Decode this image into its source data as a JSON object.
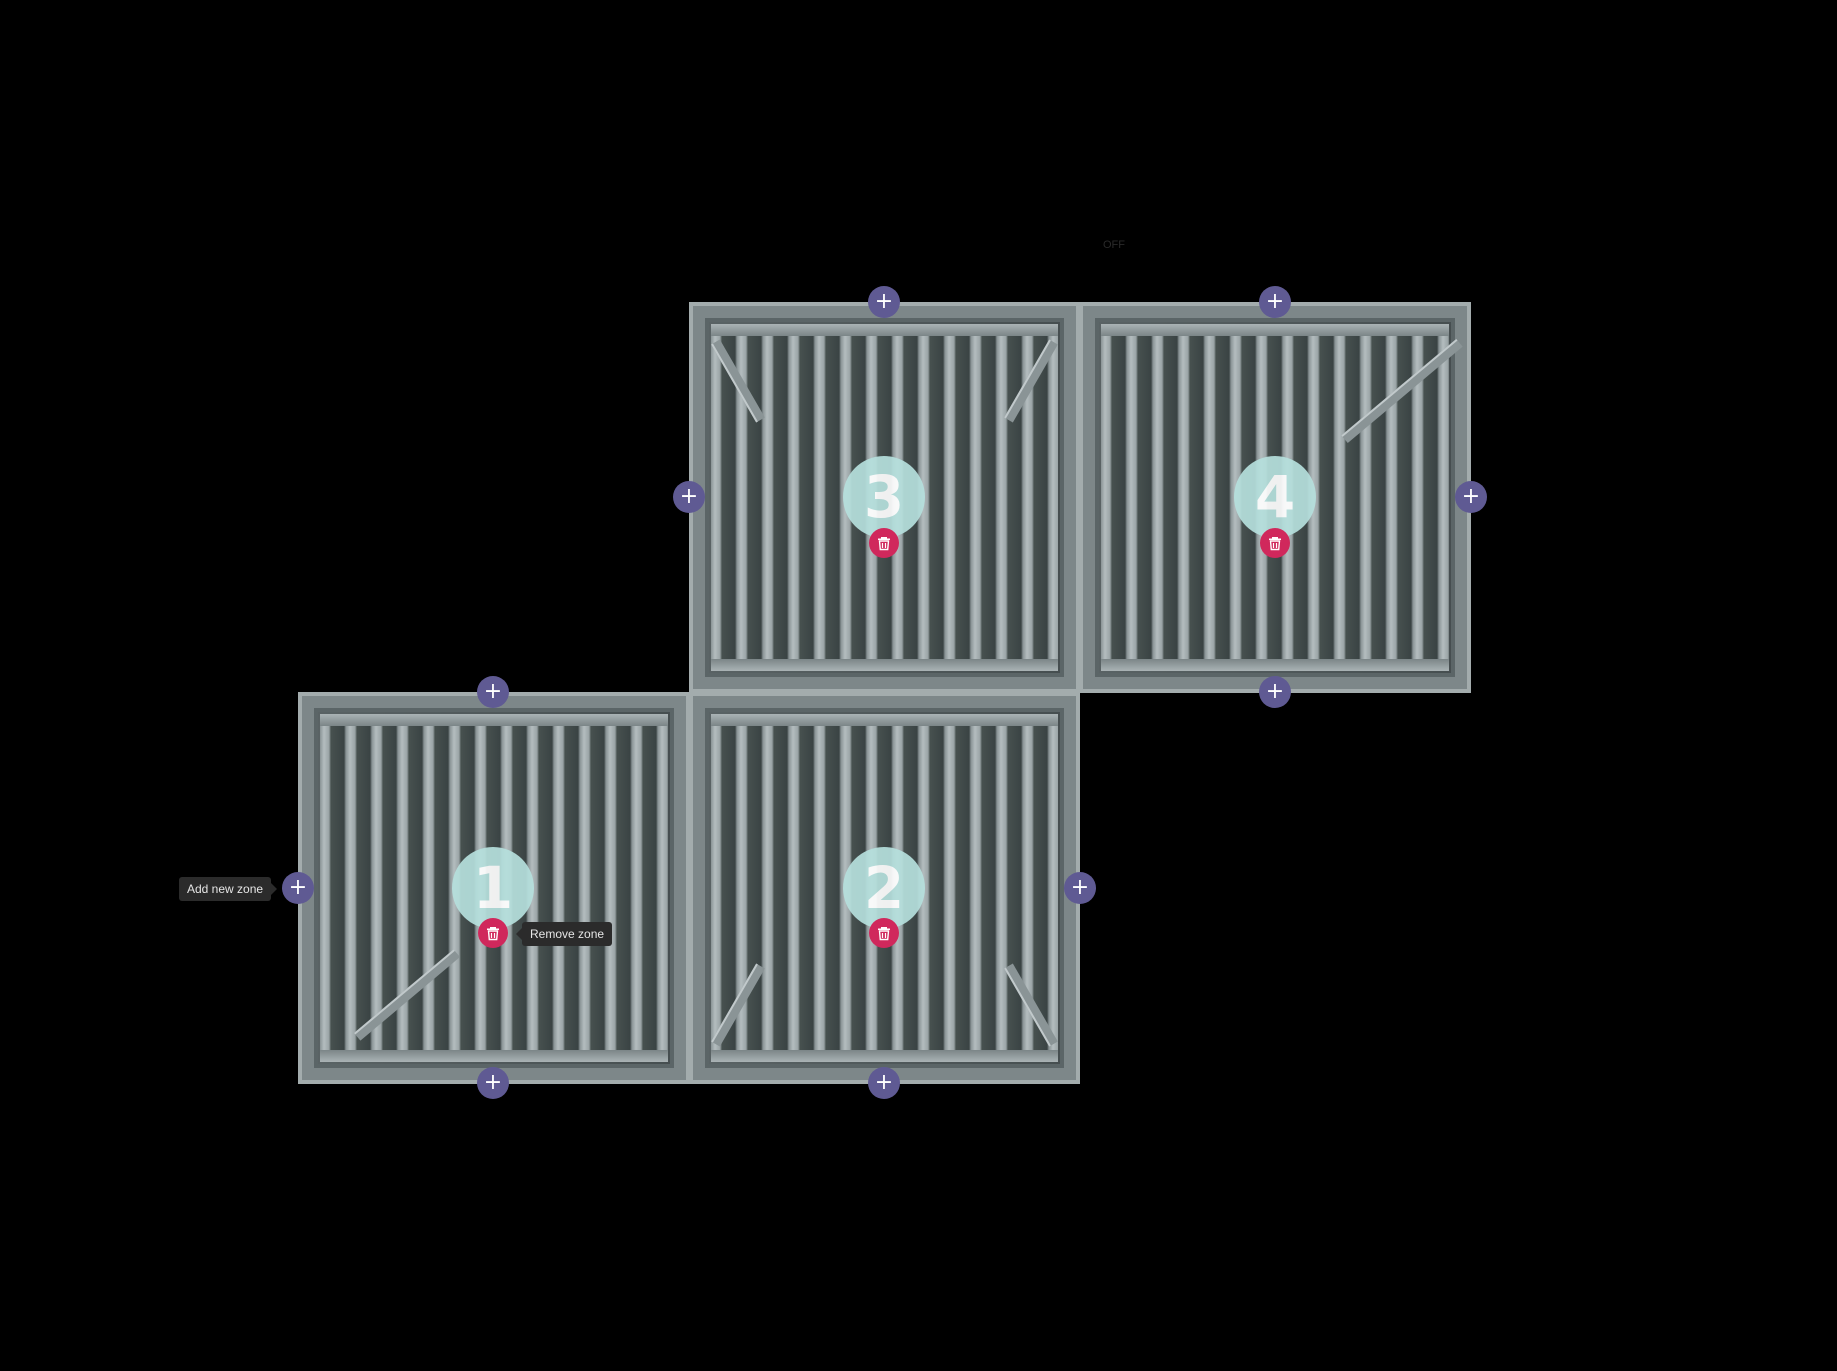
{
  "canvas": {
    "background_color": "#000000",
    "faint_label": "OFF"
  },
  "zones": [
    {
      "number": "1",
      "remove_icon": "trash-icon"
    },
    {
      "number": "2",
      "remove_icon": "trash-icon"
    },
    {
      "number": "3",
      "remove_icon": "trash-icon"
    },
    {
      "number": "4",
      "remove_icon": "trash-icon"
    }
  ],
  "add_zone_buttons": {
    "icon": "plus-icon",
    "color": "#5f5a93"
  },
  "tooltips": {
    "add_zone": "Add new zone",
    "remove_zone": "Remove zone"
  },
  "colors": {
    "zone_badge": "#b6e0dd",
    "remove_button": "#d0285c",
    "frame": "#a3acad"
  }
}
